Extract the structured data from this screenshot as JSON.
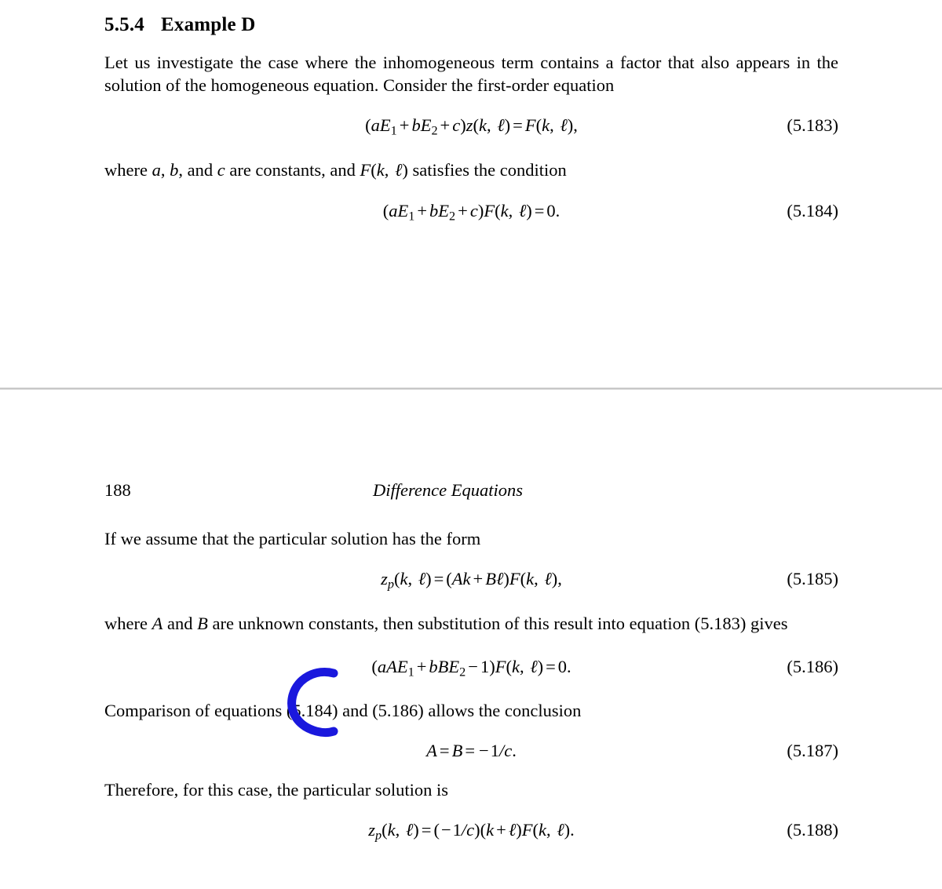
{
  "document": {
    "type": "textbook-page",
    "background_color": "#ffffff",
    "text_color": "#000000"
  },
  "section": {
    "number": "5.5.4",
    "title": "Example D"
  },
  "paragraphs": {
    "intro": "Let us investigate the case where the inhomogeneous term contains a factor that also appears in the solution of the homogeneous equation. Consider the first-order equation",
    "where_constants_pre": "where ",
    "after_183": "where a, b, and c are constants, and F(k, ℓ) satisfies the condition",
    "assume_form": "If we assume that the particular solution has the form",
    "unknown_constants": "where A and B are unknown constants, then substitution of this result into equation (5.183) gives",
    "comparison": "Comparison of equations (5.184) and (5.186) allows the conclusion",
    "therefore": "Therefore, for this case, the particular solution is"
  },
  "running_head": {
    "folio": "188",
    "title": "Difference Equations"
  },
  "equations": [
    {
      "id": "eq-5-183",
      "number": "(5.183)",
      "plain": "(aE₁ + bE₂ + c)z(k, ℓ) = F(k, ℓ),"
    },
    {
      "id": "eq-5-184",
      "number": "(5.184)",
      "plain": "(aE₁ + bE₂ + c)F(k, ℓ) = 0."
    },
    {
      "id": "eq-5-185",
      "number": "(5.185)",
      "plain": "zₚ(k, ℓ) = (Ak + Bℓ)F(k, ℓ),"
    },
    {
      "id": "eq-5-186",
      "number": "(5.186)",
      "plain": "(aAE₁ + bBE₂ − 1)F(k, ℓ) = 0."
    },
    {
      "id": "eq-5-187",
      "number": "(5.187)",
      "plain": "A = B = −1/c."
    },
    {
      "id": "eq-5-188",
      "number": "(5.188)",
      "plain": "zₚ(k, ℓ) = (−1/c)(k + ℓ)F(k, ℓ)."
    }
  ],
  "annotation": {
    "shape": "hand-drawn-c-bracket",
    "color": "#1a18dd",
    "target_equation": "(5.186)"
  }
}
